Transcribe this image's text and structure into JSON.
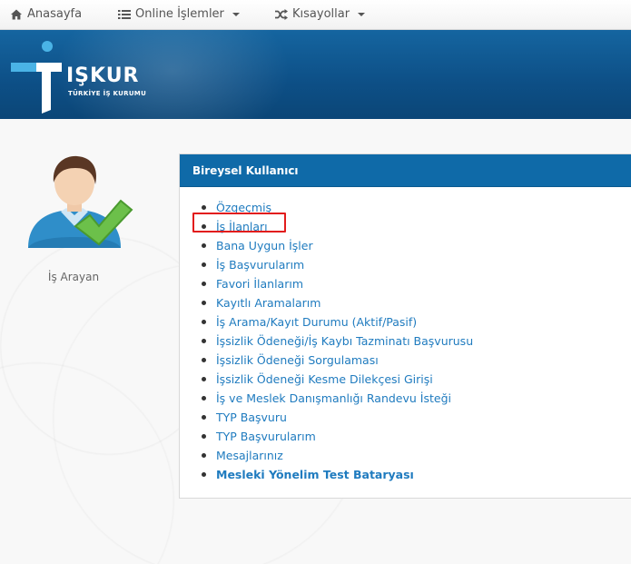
{
  "navbar": {
    "home_label": "Anasayfa",
    "online_label": "Online İşlemler",
    "shortcuts_label": "Kısayollar"
  },
  "banner": {
    "logo_title": "IŞKUR",
    "logo_subtitle": "TÜRKİYE İŞ KURUMU"
  },
  "user": {
    "role_label": "İş Arayan"
  },
  "panel": {
    "title": "Bireysel Kullanıcı",
    "items": [
      {
        "label": "Özgeçmiş"
      },
      {
        "label": "İş İlanları"
      },
      {
        "label": "Bana Uygun İşler"
      },
      {
        "label": "İş Başvurularım"
      },
      {
        "label": "Favori İlanlarım"
      },
      {
        "label": "Kayıtlı Aramalarım"
      },
      {
        "label": "İş Arama/Kayıt Durumu (Aktif/Pasif)"
      },
      {
        "label": "İşsizlik Ödeneği/İş Kaybı Tazminatı Başvurusu"
      },
      {
        "label": "İşsizlik Ödeneği Sorgulaması"
      },
      {
        "label": "İşsizlik Ödeneği Kesme Dilekçesi Girişi"
      },
      {
        "label": "İş ve Meslek Danışmanlığı Randevu İsteği"
      },
      {
        "label": "TYP Başvuru"
      },
      {
        "label": "TYP Başvurularım"
      },
      {
        "label": "Mesajlarınız"
      },
      {
        "label": "Mesleki Yönelim Test Bataryası"
      }
    ]
  },
  "colors": {
    "banner": "#0d4f86",
    "panel_header": "#0f6aa8",
    "link": "#1f7bbf",
    "highlight": "#e21c1c",
    "check": "#6cc04a"
  }
}
